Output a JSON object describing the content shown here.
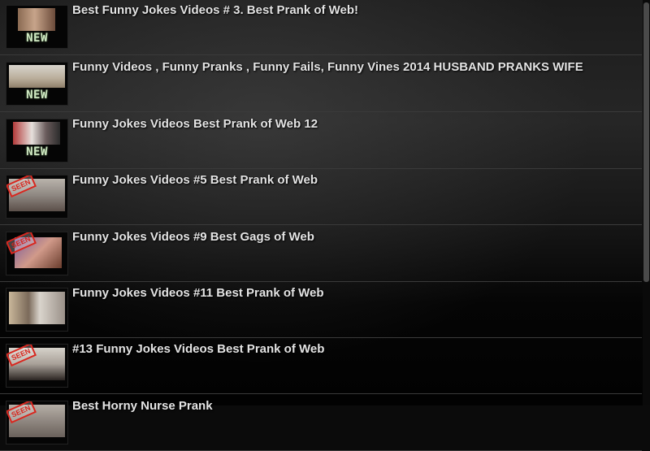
{
  "videos": [
    {
      "title": "Best Funny Jokes Videos # 3. Best Prank of Web!",
      "badge": "NEW"
    },
    {
      "title": "Funny Videos , Funny Pranks , Funny Fails, Funny Vines 2014 HUSBAND PRANKS WIFE",
      "badge": "NEW"
    },
    {
      "title": "Funny Jokes Videos Best Prank of Web 12",
      "badge": "NEW"
    },
    {
      "title": "Funny Jokes Videos #5 Best Prank of Web",
      "badge": "SEEN"
    },
    {
      "title": "Funny Jokes Videos #9 Best Gags of Web",
      "badge": "SEEN"
    },
    {
      "title": "Funny Jokes Videos #11 Best Prank of Web",
      "badge": ""
    },
    {
      "title": "#13 Funny Jokes Videos Best Prank of Web",
      "badge": "SEEN"
    },
    {
      "title": "Best Horny Nurse Prank",
      "badge": "SEEN"
    }
  ],
  "colors": {
    "new_badge": "#cfe8c2",
    "seen_stamp": "#d8261e"
  }
}
